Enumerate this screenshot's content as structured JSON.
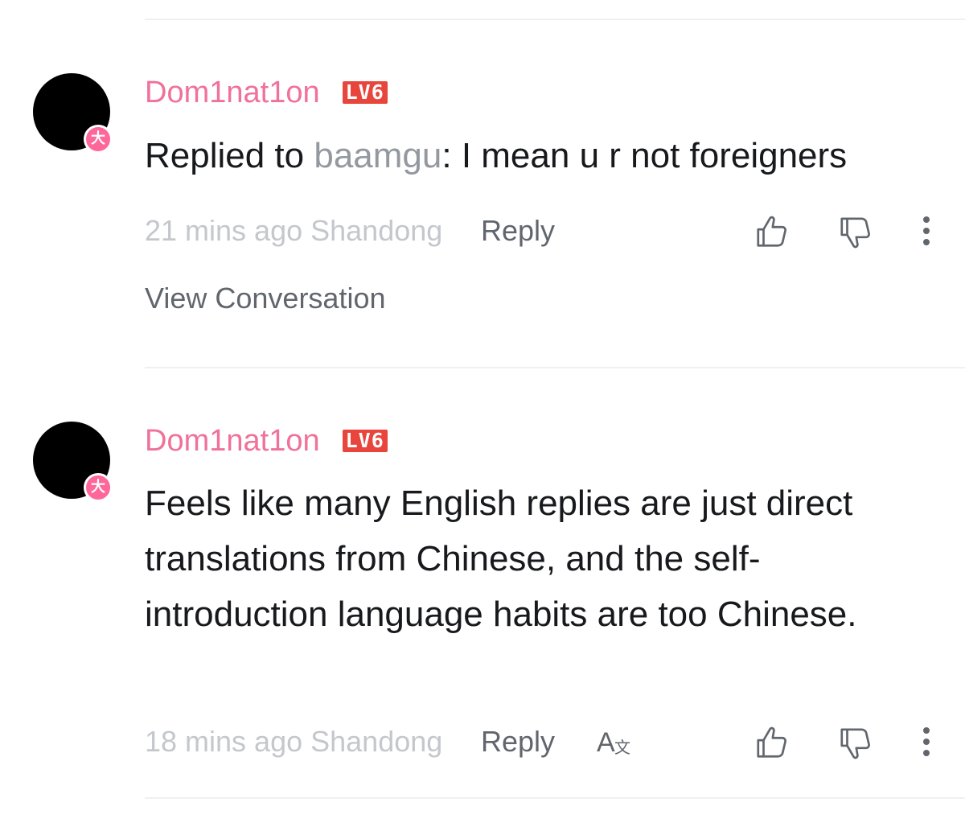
{
  "comments": [
    {
      "username": "Dom1nat1on",
      "level": "LV6",
      "avatar_badge": "大",
      "reply_prefix": "Replied to ",
      "reply_target": "baamgu",
      "text": ": I mean u r not foreigners",
      "time_location": "21 mins ago Shandong",
      "reply_label": "Reply",
      "view_conversation": "View Conversation"
    },
    {
      "username": "Dom1nat1on",
      "level": "LV6",
      "avatar_badge": "大",
      "text": "Feels like many English replies are just direct translations from Chinese, and the self-introduction language habits are too Chinese.",
      "time_location": "18 mins ago Shandong",
      "reply_label": "Reply"
    }
  ],
  "icons": {
    "like": "thumbs-up-icon",
    "dislike": "thumbs-down-icon",
    "more": "more-vertical-icon",
    "translate": "translate-icon"
  },
  "colors": {
    "username": "#f0719a",
    "level_badge": "#e8453c",
    "vip_badge": "#ff6699",
    "secondary_text": "#9499a0",
    "meta_text": "#c4c7cc"
  }
}
